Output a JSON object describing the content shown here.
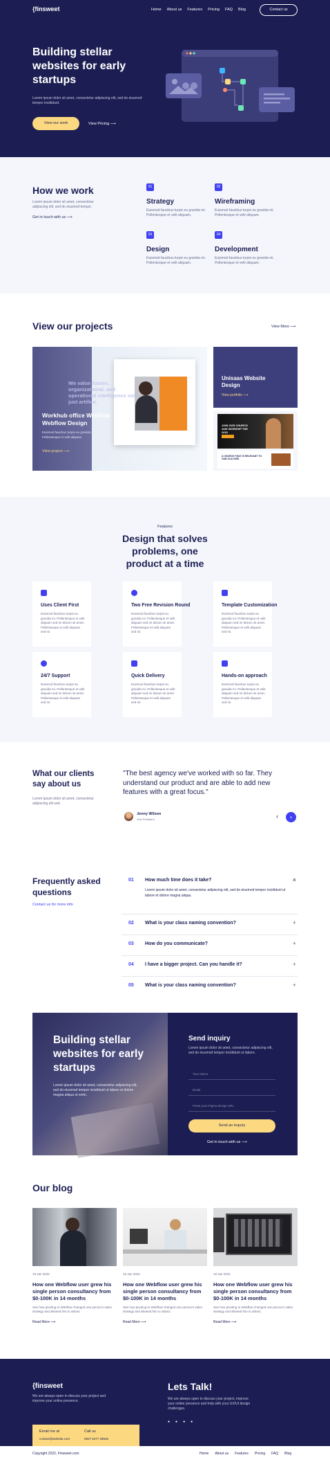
{
  "nav": {
    "logo": "{finsweet",
    "links": [
      "Home",
      "About us",
      "Features",
      "Pricing",
      "FAQ",
      "Blog"
    ],
    "cta": "Contact us"
  },
  "hero": {
    "title": "Building stellar websites for early startups",
    "desc": "Lorem ipsum dolor sit amet, consectetur adipiscing elit, sed do eiusmod tempor incididunt.",
    "primary": "View our work",
    "secondary": "View Pricing"
  },
  "how": {
    "title": "How we work",
    "desc": "Lorem ipsum dolor sit amet, consectetur adipiscing elit, sed do eiusmod tempor.",
    "link": "Get in touch with us",
    "steps": [
      {
        "num": "01",
        "title": "Strategy",
        "desc": "Euismod faucibus turpis eu gravida mi. Pellentesque et velit aliquam."
      },
      {
        "num": "02",
        "title": "Wireframing",
        "desc": "Euismod faucibus turpis eu gravida mi. Pellentesque et velit aliquam."
      },
      {
        "num": "03",
        "title": "Design",
        "desc": "Euismod faucibus turpis eu gravida mi. Pellentesque et velit aliquam."
      },
      {
        "num": "04",
        "title": "Development",
        "desc": "Euismod faucibus turpis eu gravida mi. Pellentesque et velit aliquam."
      }
    ]
  },
  "projects": {
    "title": "View our projects",
    "more": "View More",
    "main": {
      "title": "Workhub office Webflow Webflow Design",
      "desc": "Euismod faucibus turpis eu gravida mi. Pellentesque et velit aliquam.",
      "link": "View project",
      "overlay": "We value fusion, organizational, and operational intelligence not just artifice."
    },
    "side": {
      "title": "Unisaas Website Design",
      "link": "View portfolio",
      "mini_title": "JOIN OUR CHURCH AND WORSHIP THE GOD",
      "mini_footer": "A CHURCH THAT IS RELEVANT TO OUR CULTURE"
    }
  },
  "features": {
    "eyebrow": "Features",
    "title": "Design that solves problems, one product at a time",
    "items": [
      {
        "title": "Uses Client First",
        "desc": "Euismod faucibus turpis eu gravida mi. Pellentesque et velit aliquam sed mi dictum sit amet. Pellentesque et velit aliquam sed mi."
      },
      {
        "title": "Two Free Revision Round",
        "desc": "Euismod faucibus turpis eu gravida mi. Pellentesque et velit aliquam sed mi dictum sit amet. Pellentesque et velit aliquam sed mi."
      },
      {
        "title": "Template Customization",
        "desc": "Euismod faucibus turpis eu gravida mi. Pellentesque et velit aliquam sed mi dictum sit amet. Pellentesque et velit aliquam sed mi."
      },
      {
        "title": "24/7 Support",
        "desc": "Euismod faucibus turpis eu gravida mi. Pellentesque et velit aliquam sed mi dictum sit amet. Pellentesque et velit aliquam sed mi."
      },
      {
        "title": "Quick Delivery",
        "desc": "Euismod faucibus turpis eu gravida mi. Pellentesque et velit aliquam sed mi dictum sit amet. Pellentesque et velit aliquam sed mi."
      },
      {
        "title": "Hands-on approach",
        "desc": "Euismod faucibus turpis eu gravida mi. Pellentesque et velit aliquam sed mi dictum sit amet. Pellentesque et velit aliquam sed mi."
      }
    ]
  },
  "testimonial": {
    "title": "What our clients say about us",
    "desc": "Lorem ipsum dolor sit amet, consectetur adipiscing elit sed.",
    "quote": "\"The best agency we've worked with so far. They understand our product and are able to add new features with a great focus.\"",
    "name": "Jenny Wilson",
    "role": "Vice President"
  },
  "faq": {
    "title": "Frequently asked questions",
    "link": "Contact us for more info",
    "items": [
      {
        "num": "01",
        "q": "How much time does it take?",
        "a": "Lorem ipsum dolor sit amet, consectetur adipiscing elit, sed do eiusmod tempor incididunt ut labore et dolore magna aliqua."
      },
      {
        "num": "02",
        "q": "What is your class naming convention?"
      },
      {
        "num": "03",
        "q": "How do you communicate?"
      },
      {
        "num": "04",
        "q": "I have a bigger project. Can you handle it?"
      },
      {
        "num": "05",
        "q": "What is your class naming convention?"
      }
    ]
  },
  "cta": {
    "title": "Building stellar websites for early startups",
    "desc": "Lorem ipsum dolor sit amet, consectetur adipiscing elit, sed do eiusmod tempor incididunt ut labore et dolore magna aliqua ut enim.",
    "form_title": "Send inquiry",
    "form_desc": "Lorem ipsum dolor sit amet, consectetur adipiscing elit, sed do eiusmod tempor incididunt ut labore.",
    "name_ph": "Your Name",
    "email_ph": "Email",
    "figma_ph": "Paste your Figma design URL",
    "submit": "Send an Inquiry",
    "link": "Get in touch with us"
  },
  "blog": {
    "title": "Our blog",
    "posts": [
      {
        "date": "19 Jan 2022",
        "title": "How one Webflow user grew his single person consultancy from $0-100K in 14 months",
        "excerpt": "See how pivoting to Webflow changed one person's sales strategy and allowed him to attract.",
        "more": "Read More"
      },
      {
        "date": "19 Jan 2022",
        "title": "How one Webflow user grew his single person consultancy from $0-100K in 14 months",
        "excerpt": "See how pivoting to Webflow changed one person's sales strategy and allowed him to attract.",
        "more": "Read More"
      },
      {
        "date": "19 Jan 2022",
        "title": "How one Webflow user grew his single person consultancy from $0-100K in 14 months",
        "excerpt": "See how pivoting to Webflow changed one person's sales strategy and allowed him to attract.",
        "more": "Read More"
      }
    ]
  },
  "footer": {
    "logo": "{finsweet",
    "desc": "We are always open to discuss your project and improve your online presence.",
    "email_label": "Email me at",
    "email": "contact@website.com",
    "call_label": "Call us",
    "phone": "0927 6277 28525",
    "talk_title": "Lets Talk!",
    "talk_desc": "We are always open to discuss your project, improve your online presence and help with your UX/UI design challenges.",
    "copyright": "Copyright 2022, Finsweet.com",
    "links": [
      "Home",
      "About us",
      "Features",
      "Pricing",
      "FAQ",
      "Blog"
    ]
  },
  "colors": {
    "navy": "#1c1e53",
    "yellow": "#fcd980",
    "blue": "#4040f0",
    "light": "#f4f6fc"
  }
}
